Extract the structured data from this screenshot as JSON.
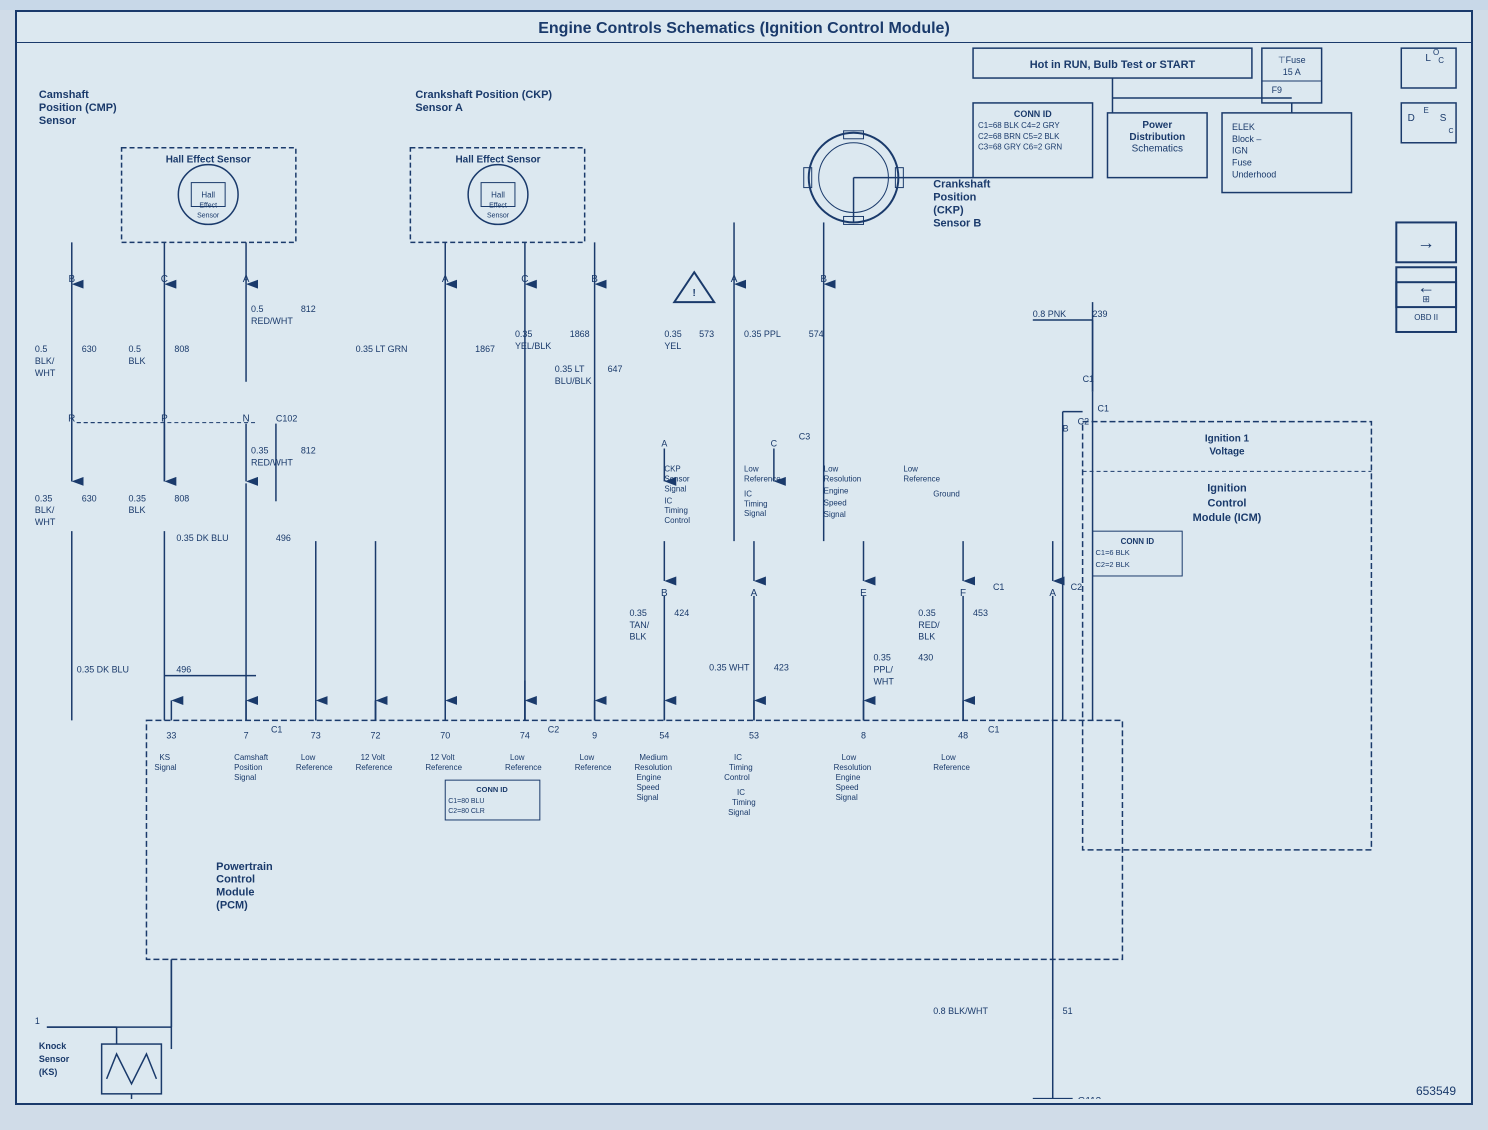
{
  "page": {
    "title": "Engine Controls Schematics (Ignition Control Module)",
    "doc_number": "653549"
  },
  "components": {
    "cmp_sensor": "Camshaft Position (CMP) Sensor",
    "hall_effect_1": "Hall Effect Sensor",
    "hall_effect_2": "Hall Effect Sensor",
    "ckp_sensor_a": "Crankshaft Position (CKP) Sensor A",
    "ckp_sensor_b": "Crankshaft\nPosition\n(CKP)\nSensor B",
    "knock_sensor": "Knock\nSensor\n(KS)",
    "pcm": "Powertrain\nControl\nModule\n(PCM)",
    "icm": "Ignition 1\nVoltage\nIgnition\nControl\nModule (ICM)",
    "power_dist": "Power\nDistribution\nSchematics",
    "elek_block": "ELEK\nBlock –\nIGN\nFuse\nUnderhood",
    "hot_run": "Hot in RUN, Bulb Test or START",
    "fuse_15a": "15 A",
    "f9": "F9",
    "conn_id_1": "CONN ID\nC1=68 BLK  C4=2 GRY\nC2=68 BRN  C5=2 BLK\nC3=68 GRY  C6=2 GRN",
    "conn_id_2": "CONN ID\nC1=6 BLK\nC2=2 BLK",
    "conn_id_3": "CONN ID\nC1=80 BLU\nC2=80 CLR"
  },
  "wires": {
    "w1": "0.5 BLK/WHT",
    "w2": "630",
    "w3": "0.5 BLK",
    "w4": "808",
    "w5": "0.5 RED/WHT",
    "w6": "812",
    "w7": "0.35 RED/WHT",
    "w8": "812",
    "w9": "0.35 BLK",
    "w10": "808",
    "w11": "0.35 BLK/WHT",
    "w12": "630",
    "w13": "0.35 LT GRN",
    "w14": "1867",
    "w15": "0.35 YEL/BLK",
    "w16": "1868",
    "w17": "0.35 LT BLU/BLK",
    "w18": "647",
    "w19": "0.35 YEL",
    "w20": "573",
    "w21": "0.35 PPL",
    "w22": "574",
    "w23": "0.8 PNK",
    "w24": "239",
    "w25": "0.35 TAN/BLK",
    "w26": "424",
    "w27": "0.35 RED/BLK",
    "w28": "453",
    "w29": "0.35 WHT",
    "w30": "423",
    "w31": "0.35 PPL/WHT",
    "w32": "430",
    "w33": "0.35 DK BLU",
    "w34": "496",
    "w35": "0.8 BLK/WHT",
    "w36": "51"
  },
  "pins": {
    "icm_pins": [
      "B",
      "A",
      "E",
      "F",
      "C1",
      "A",
      "C2"
    ],
    "pcm_pins_top": [
      "33",
      "7 C1",
      "73",
      "72",
      "70",
      "74 C2",
      "9",
      "54",
      "53",
      "8",
      "48 C1"
    ],
    "cmp_pins": [
      "B",
      "C",
      "A",
      "R",
      "P",
      "N C102"
    ],
    "ckp_a_pins": [
      "A",
      "C",
      "B"
    ],
    "ckp_b_pins": [
      "A",
      "B"
    ]
  }
}
